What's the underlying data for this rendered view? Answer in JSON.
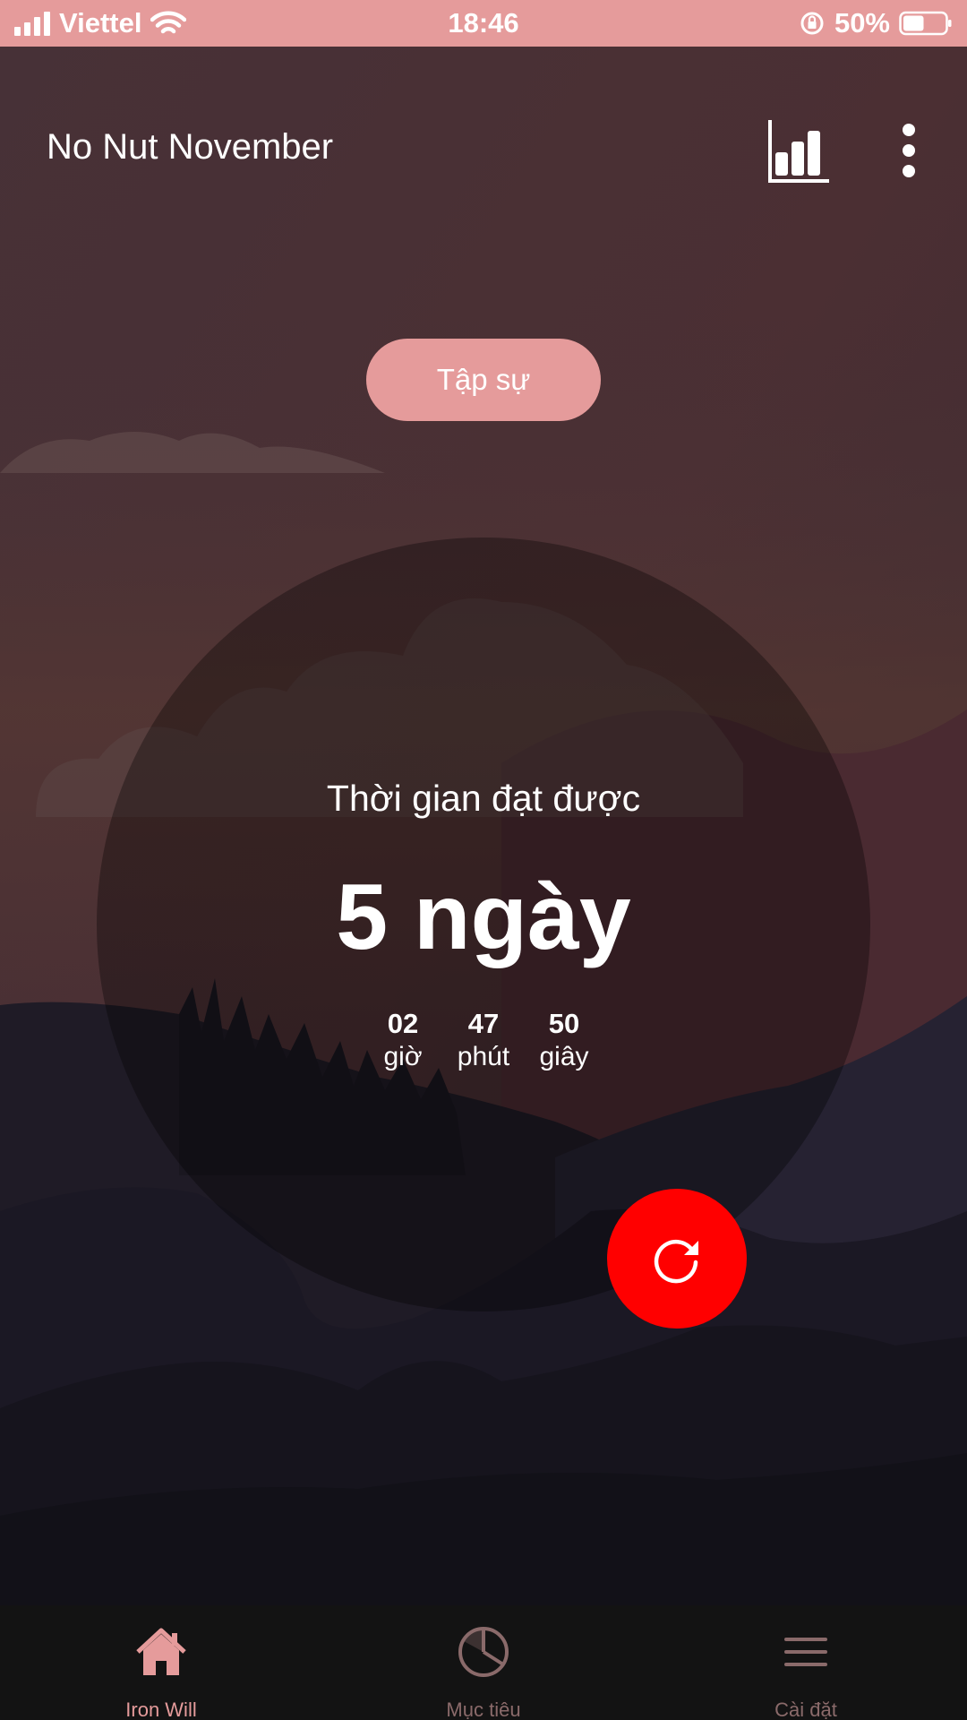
{
  "status_bar": {
    "carrier": "Viettel",
    "time": "18:46",
    "battery": "50%",
    "battery_level": 0.5
  },
  "header": {
    "title": "No Nut November",
    "stats_icon": "bar-chart-icon",
    "more_icon": "more-vertical-icon"
  },
  "rank": {
    "label": "Tập sự"
  },
  "timer": {
    "label": "Thời gian đạt được",
    "days_display": "5 ngày",
    "hours": "02",
    "hours_label": "giờ",
    "minutes": "47",
    "minutes_label": "phút",
    "seconds": "50",
    "seconds_label": "giây"
  },
  "reset_button": {
    "icon": "refresh-icon"
  },
  "bottom_nav": {
    "items": [
      {
        "label": "Iron Will",
        "icon": "home-icon",
        "active": true
      },
      {
        "label": "Mục tiêu",
        "icon": "pie-chart-icon",
        "active": false
      },
      {
        "label": "Cài đặt",
        "icon": "menu-icon",
        "active": false
      }
    ]
  },
  "colors": {
    "accent": "#e59b9b",
    "reset": "#ff0000",
    "nav_background": "#131313"
  }
}
